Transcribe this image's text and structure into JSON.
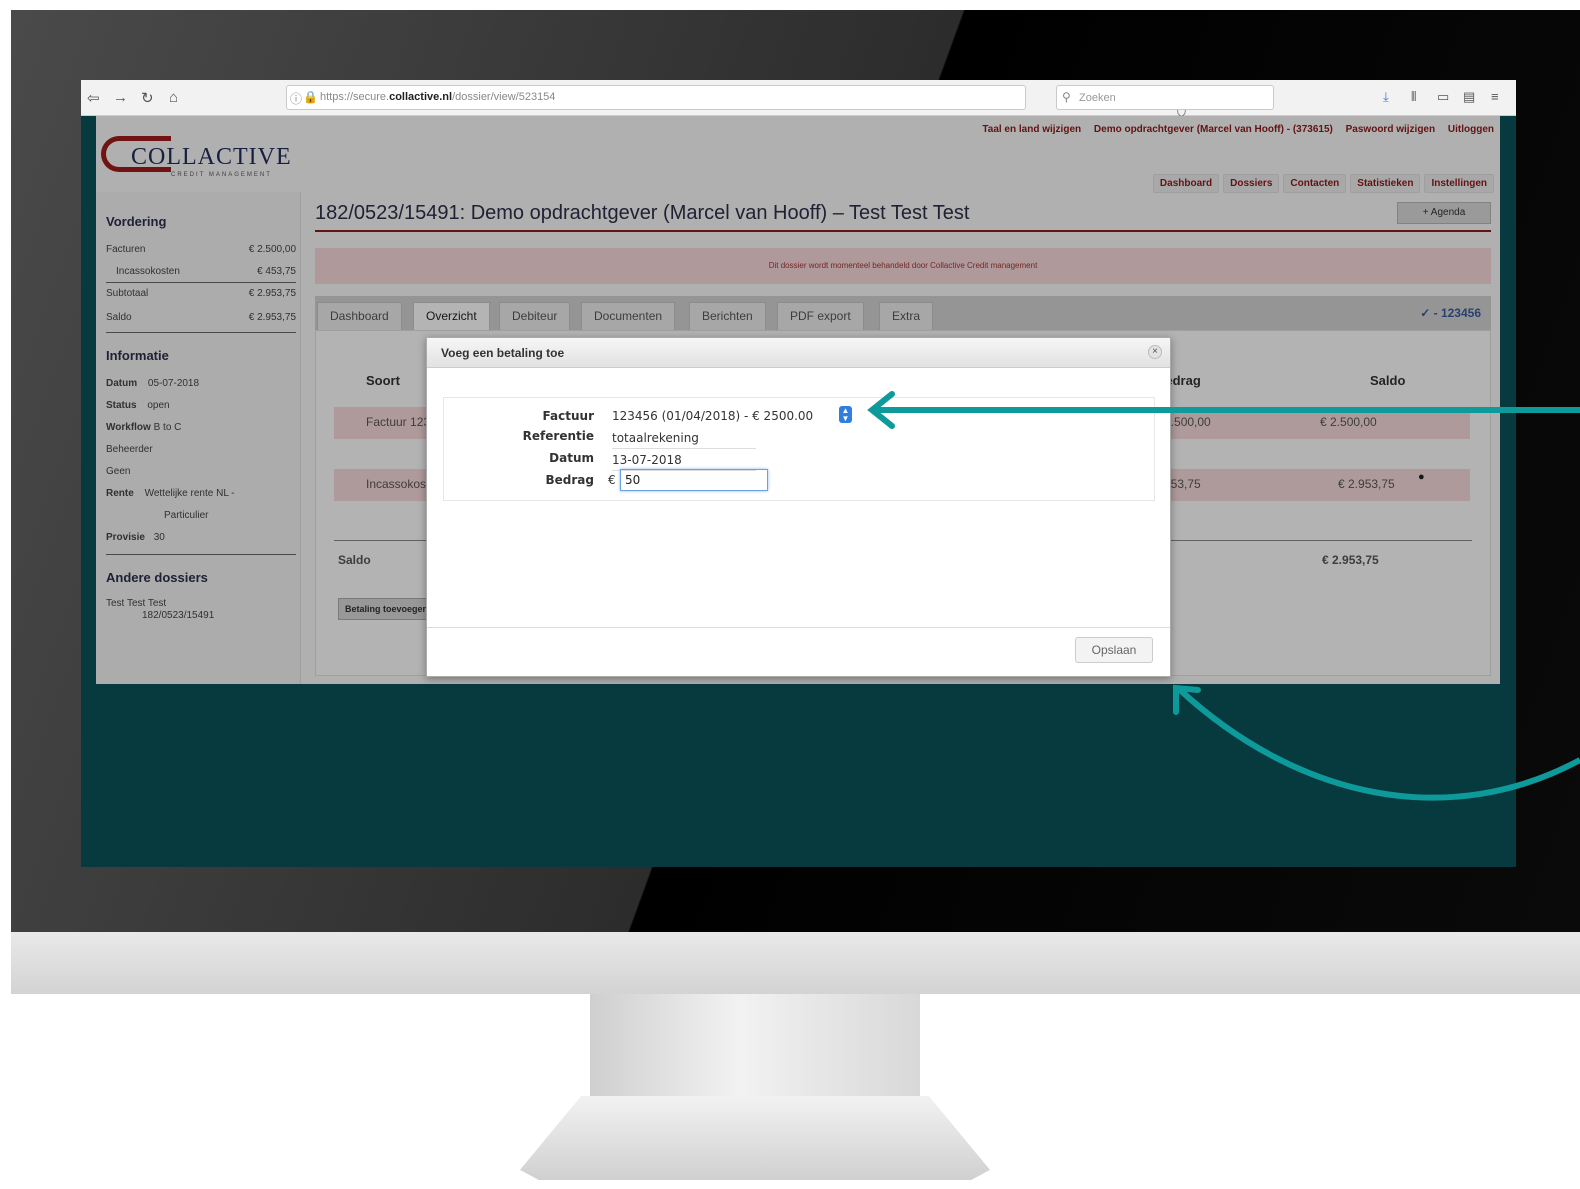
{
  "browser": {
    "url_prefix": "https://secure.",
    "url_domain": "collactive.nl",
    "url_path": "/dossier/view/523154",
    "url_more": "··· ⛉ ☆",
    "search_placeholder": "Zoeken"
  },
  "header": {
    "logo_text": "COLLACTIVE",
    "logo_sub": "CREDIT MANAGEMENT",
    "top_links": [
      "Taal en land wijzigen",
      "Demo opdrachtgever (Marcel van Hooff) - (373615)",
      "Paswoord wijzigen",
      "Uitloggen"
    ],
    "main_nav": [
      "Dashboard",
      "Dossiers",
      "Contacten",
      "Statistieken",
      "Instellingen"
    ]
  },
  "sidebar": {
    "vordering_heading": "Vordering",
    "facturen_label": "Facturen",
    "facturen_value": "€ 2.500,00",
    "incasso_label": "Incassokosten",
    "incasso_value": "€ 453,75",
    "subtotaal_label": "Subtotaal",
    "subtotaal_value": "€ 2.953,75",
    "saldo_label": "Saldo",
    "saldo_value": "€ 2.953,75",
    "informatie_heading": "Informatie",
    "datum_label": "Datum",
    "datum_value": "05-07-2018",
    "status_label": "Status",
    "status_value": "open",
    "workflow_label": "Workflow",
    "workflow_value": "B to C",
    "beheerder_label": "Beheerder",
    "beheerder_value": "Geen",
    "rente_label": "Rente",
    "rente_value_1": "Wettelijke rente NL -",
    "rente_value_2": "Particulier",
    "provisie_label": "Provisie",
    "provisie_value": "30",
    "andere_heading": "Andere dossiers",
    "andere_item_1": "Test Test Test",
    "andere_item_2": "182/0523/15491"
  },
  "main": {
    "title": "182/0523/15491: Demo opdrachtgever (Marcel van Hooff) – Test Test Test",
    "agenda_button": "+ Agenda",
    "notice": "Dit dossier wordt momenteel behandeld door Collactive Credit management",
    "tabs": [
      "Dashboard",
      "Overzicht",
      "Debiteur",
      "Documenten",
      "Berichten",
      "PDF export",
      "Extra"
    ],
    "tab_code": "✓ - 123456",
    "table": {
      "col_soort": "Soort",
      "col_bedrag": "Bedrag",
      "col_saldo": "Saldo",
      "row1_soort": "Factuur 123456",
      "row1_bedrag": "€ 2.500,00",
      "row1_saldo": "€ 2.500,00",
      "row2_soort": "Incassokosten",
      "row2_bedrag": "€ 453,75",
      "row2_saldo": "€ 2.953,75",
      "total_label": "Saldo",
      "total_value": "€ 2.953,75"
    },
    "add_payment_button": "Betaling toevoegen"
  },
  "modal": {
    "title": "Voeg een betaling toe",
    "close": "×",
    "factuur_label": "Factuur",
    "factuur_value": "123456 (01/04/2018) - € 2500.00",
    "referentie_label": "Referentie",
    "referentie_value": "totaalrekening",
    "datum_label": "Datum",
    "datum_value": "13-07-2018",
    "bedrag_label": "Bedrag",
    "bedrag_currency": "€",
    "bedrag_value": "50",
    "save_button": "Opslaan"
  },
  "colors": {
    "accent_red": "#8b1a1a",
    "annotation_teal": "#0e9a9a",
    "screen_bg": "#063a3e"
  }
}
